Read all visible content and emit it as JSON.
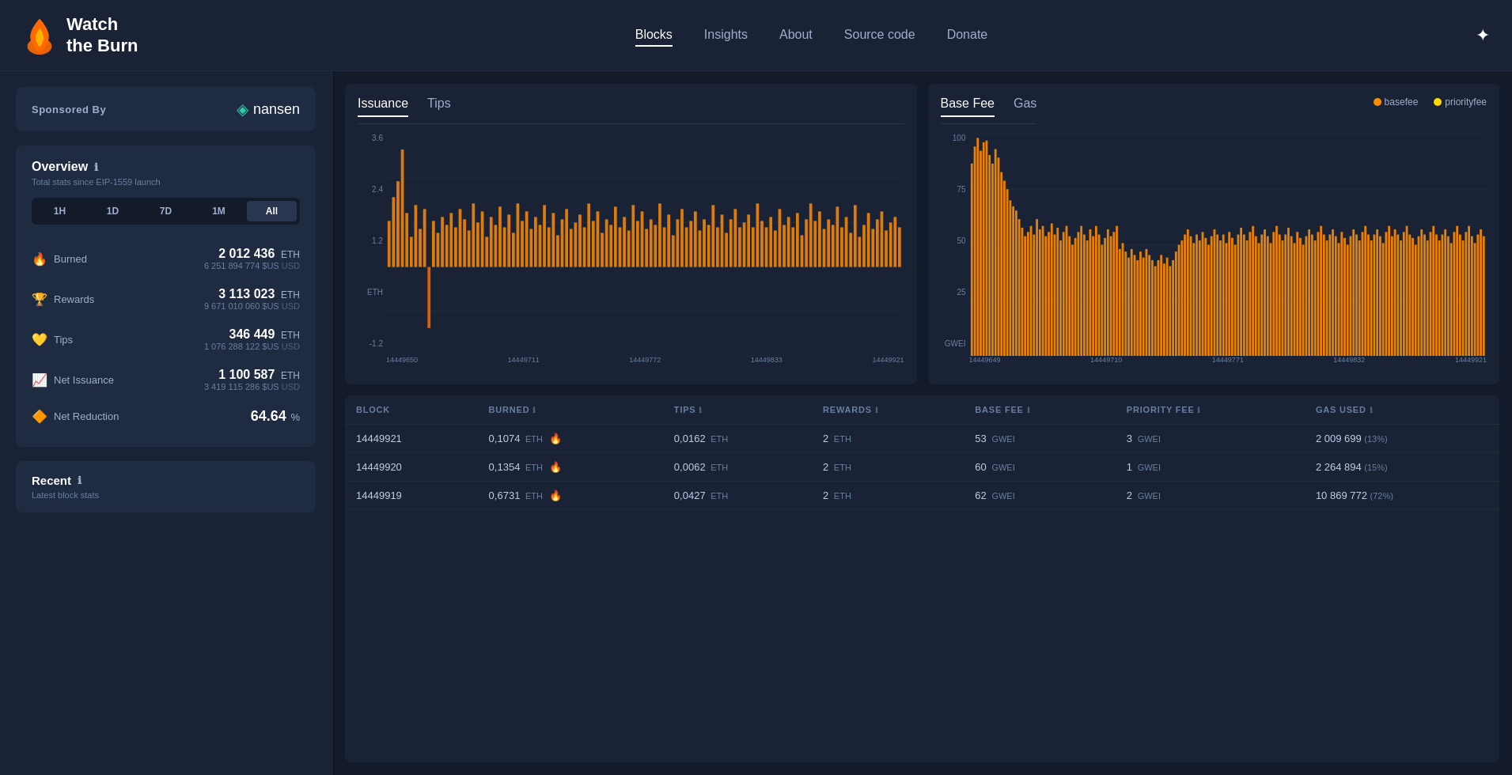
{
  "header": {
    "logo_text": "Watch\nthe Burn",
    "nav_items": [
      {
        "label": "Blocks",
        "active": true
      },
      {
        "label": "Insights",
        "active": false
      },
      {
        "label": "About",
        "active": false
      },
      {
        "label": "Source code",
        "active": false
      },
      {
        "label": "Donate",
        "active": false
      }
    ]
  },
  "sidebar": {
    "sponsor_label": "Sponsored By",
    "nansen_label": "nansen",
    "overview_title": "Overview",
    "overview_subtitle": "Total stats since EIP-1559 launch",
    "time_filters": [
      "1H",
      "1D",
      "7D",
      "1M",
      "All"
    ],
    "active_filter": "All",
    "stats": [
      {
        "icon": "🔥",
        "label": "Burned",
        "value": "2 012 436",
        "unit": "ETH",
        "usd": "6 251 894 774 $US",
        "usd_unit": "USD"
      },
      {
        "icon": "🏆",
        "label": "Rewards",
        "value": "3 113 023",
        "unit": "ETH",
        "usd": "9 671 010 060 $US",
        "usd_unit": "USD"
      },
      {
        "icon": "💛",
        "label": "Tips",
        "value": "346 449",
        "unit": "ETH",
        "usd": "1 076 288 122 $US",
        "usd_unit": "USD"
      },
      {
        "icon": "📈",
        "label": "Net Issuance",
        "value": "1 100 587",
        "unit": "ETH",
        "usd": "3 419 115 286 $US",
        "usd_unit": "USD"
      },
      {
        "icon": "🔶",
        "label": "Net Reduction",
        "value": "64.64",
        "unit": "%",
        "usd": null
      }
    ],
    "recent_title": "Recent",
    "recent_subtitle": "Latest block stats"
  },
  "charts": {
    "issuance_tab": "Issuance",
    "tips_tab": "Tips",
    "basefee_tab": "Base Fee",
    "gas_tab": "Gas",
    "basefee_legend": "basefee",
    "priorityfee_legend": "priorityfee",
    "left_y_labels": [
      "3.6",
      "2.4",
      "1.2",
      "ETH",
      "-1.2"
    ],
    "left_x_labels": [
      "14449650",
      "14449711",
      "14449772",
      "14449833",
      "14449921"
    ],
    "right_y_labels": [
      "100",
      "75",
      "50",
      "25",
      "GWEI"
    ],
    "right_x_labels": [
      "14449649",
      "14449710",
      "14449771",
      "14449832",
      "14449921"
    ]
  },
  "table": {
    "columns": [
      {
        "label": "BLOCK",
        "info": false
      },
      {
        "label": "BURNED",
        "info": true
      },
      {
        "label": "TIPS",
        "info": true
      },
      {
        "label": "REWARDS",
        "info": true
      },
      {
        "label": "BASE FEE",
        "info": true
      },
      {
        "label": "PRIORITY FEE",
        "info": true
      },
      {
        "label": "GAS USED",
        "info": true
      }
    ],
    "rows": [
      {
        "block": "14449921",
        "burned": "0,1074",
        "burned_unit": "ETH",
        "tips": "0,0162",
        "tips_unit": "ETH",
        "rewards": "2",
        "rewards_unit": "ETH",
        "basefee": "53",
        "basefee_unit": "GWEI",
        "priorityfee": "3",
        "priorityfee_unit": "GWEI",
        "gasused": "2 009 699",
        "gasused_pct": "13%"
      },
      {
        "block": "14449920",
        "burned": "0,1354",
        "burned_unit": "ETH",
        "tips": "0,0062",
        "tips_unit": "ETH",
        "rewards": "2",
        "rewards_unit": "ETH",
        "basefee": "60",
        "basefee_unit": "GWEI",
        "priorityfee": "1",
        "priorityfee_unit": "GWEI",
        "gasused": "2 264 894",
        "gasused_pct": "15%"
      },
      {
        "block": "14449919",
        "burned": "0,6731",
        "burned_unit": "ETH",
        "tips": "0,0427",
        "tips_unit": "ETH",
        "rewards": "2",
        "rewards_unit": "ETH",
        "basefee": "62",
        "basefee_unit": "GWEI",
        "priorityfee": "2",
        "priorityfee_unit": "GWEI",
        "gasused": "10 869 772",
        "gasused_pct": "72%"
      }
    ]
  }
}
